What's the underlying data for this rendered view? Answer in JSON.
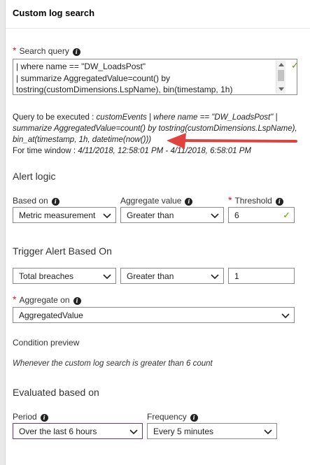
{
  "panel": {
    "title": "Custom log search"
  },
  "query": {
    "label": "Search query",
    "lines": [
      "| where name == \"DW_LoadsPost\"",
      "| summarize AggregatedValue=count() by",
      "tostring(customDimensions.LspName), bin(timestamp, 1h)"
    ]
  },
  "execution": {
    "prefix": "Query to be executed : ",
    "lines": [
      "customEvents | where name == \"DW_LoadsPost\" |",
      "summarize AggregatedValue=count() by tostring(customDimensions.LspName),",
      "bin_at(timestamp, 1h, datetime(now()))"
    ],
    "window_label": "For time window : ",
    "window_value": "4/11/2018, 12:58:01 PM - 4/11/2018, 6:58:01 PM"
  },
  "alert_logic": {
    "heading": "Alert logic",
    "based_on_label": "Based on",
    "based_on_value": "Metric measurement",
    "aggregate_value_label": "Aggregate value",
    "aggregate_value_value": "Greater than",
    "threshold_label": "Threshold",
    "threshold_value": "6"
  },
  "trigger": {
    "heading": "Trigger Alert Based On",
    "breaches_value": "Total breaches",
    "operator_value": "Greater than",
    "count_value": "1",
    "aggregate_on_label": "Aggregate on",
    "aggregate_on_value": "AggregatedValue"
  },
  "preview": {
    "heading": "Condition preview",
    "text": "Whenever the custom log search is greater than 6 count"
  },
  "evaluation": {
    "heading": "Evaluated based on",
    "period_label": "Period",
    "period_value": "Over the last 6 hours",
    "frequency_label": "Frequency",
    "frequency_value": "Every 5 minutes"
  },
  "colors": {
    "accent": "#7a2f88",
    "required": "#e81123",
    "valid": "#57a300",
    "annotation_arrow": "#e0423e"
  }
}
